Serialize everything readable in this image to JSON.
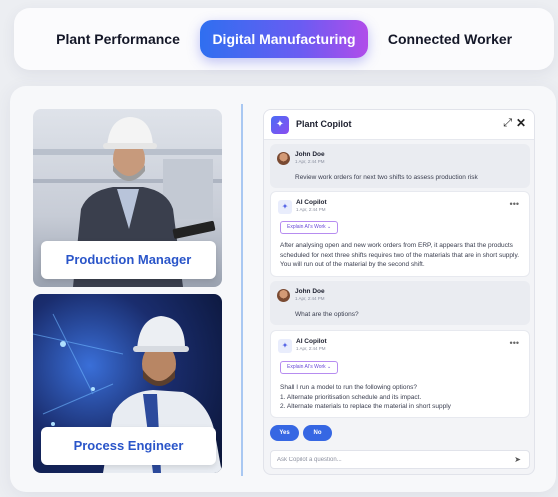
{
  "tabs": [
    {
      "label": "Plant Performance",
      "active": false
    },
    {
      "label": "Digital Manufacturing",
      "active": true
    },
    {
      "label": "Connected Worker",
      "active": false
    }
  ],
  "personas": [
    {
      "label": "Production Manager"
    },
    {
      "label": "Process Engineer"
    }
  ],
  "copilot": {
    "title": "Plant Copilot",
    "expand_icon": "expand-icon",
    "close_icon": "close-icon",
    "messages": [
      {
        "sender": "John Doe",
        "time": "1 Apr, 2:44 PM",
        "text": "Review work orders for next two shifts to assess production risk"
      },
      {
        "sender": "AI Copilot",
        "time": "1 Apr, 2:44 PM",
        "explain_label": "Explain AI's Work",
        "text": "After analysing open and new work orders from ERP, it appears that the products scheduled for next three shifts requires two of the materials that are in short supply. You will run out of the material by the second shift."
      },
      {
        "sender": "John Doe",
        "time": "1 Apr, 2:44 PM",
        "text": "What are the options?"
      },
      {
        "sender": "AI Copilot",
        "time": "1 Apr, 2:44 PM",
        "explain_label": "Explain AI's Work",
        "text_lines": [
          "Shall I run a model to run the following options?",
          "1. Alternate prioritisation schedule and its impact.",
          "2. Alternate materials to replace the material in short supply"
        ]
      }
    ],
    "choices": {
      "yes": "Yes",
      "no": "No"
    },
    "input_placeholder": "Ask Copilot a question...",
    "colors": {
      "accent": "#3667e3",
      "brand_gradient_start": "#2f6ff0",
      "brand_gradient_end": "#b14dea"
    }
  }
}
